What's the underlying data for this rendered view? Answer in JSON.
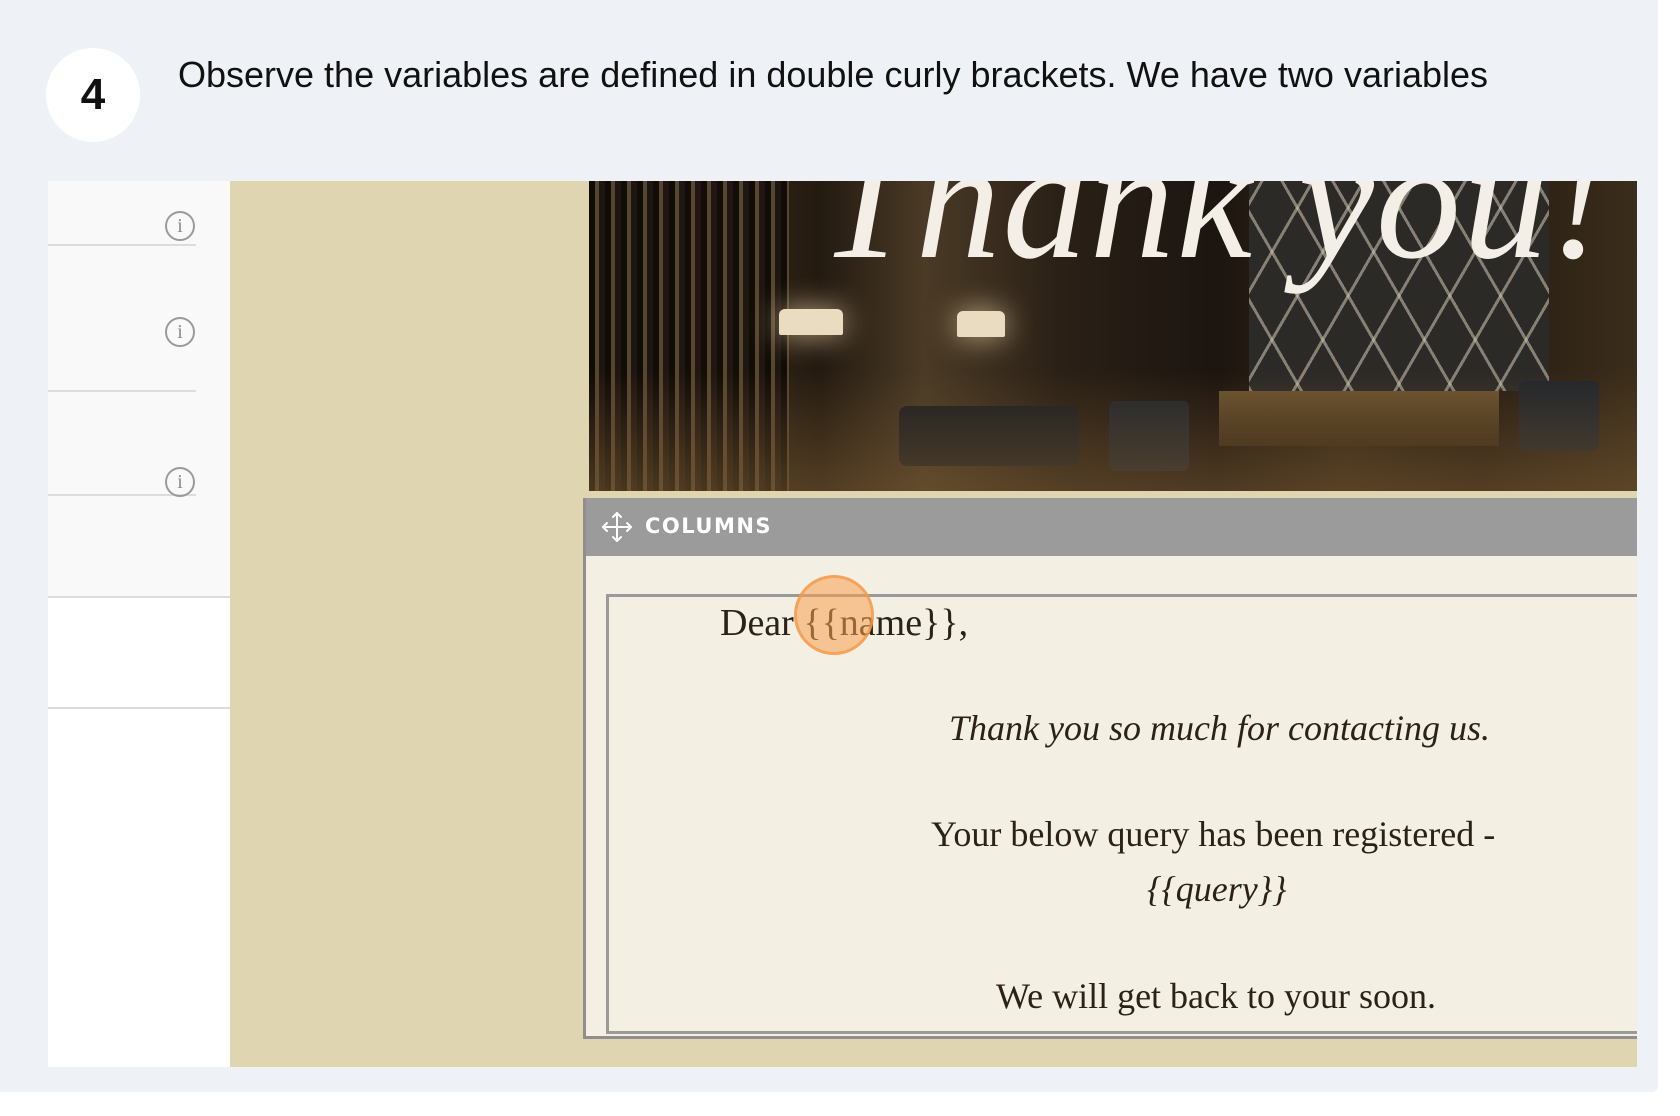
{
  "step": {
    "number": "4",
    "instruction": "Observe the variables are defined in double curly brackets. We have two variables"
  },
  "screenshot": {
    "side_panel": {
      "info_icons": [
        "info-icon",
        "info-icon",
        "info-icon"
      ]
    },
    "hero_banner": {
      "title": "Thank you!"
    },
    "columns_block": {
      "label": "COLUMNS",
      "icon": "move-icon"
    },
    "letter": {
      "greeting": "Dear {{name}},",
      "thanks": "Thank you so much for contacting us.",
      "query_line": "Your below query has been registered -",
      "query_variable": "{{query}}",
      "closing": "We will get back to your soon."
    }
  },
  "colors": {
    "card_background": "#eef2f7",
    "canvas_background": "#dfd5b0",
    "columns_bar": "#9b9b9b",
    "letter_background": "#f3efe3",
    "click_marker": "#f7a050"
  }
}
